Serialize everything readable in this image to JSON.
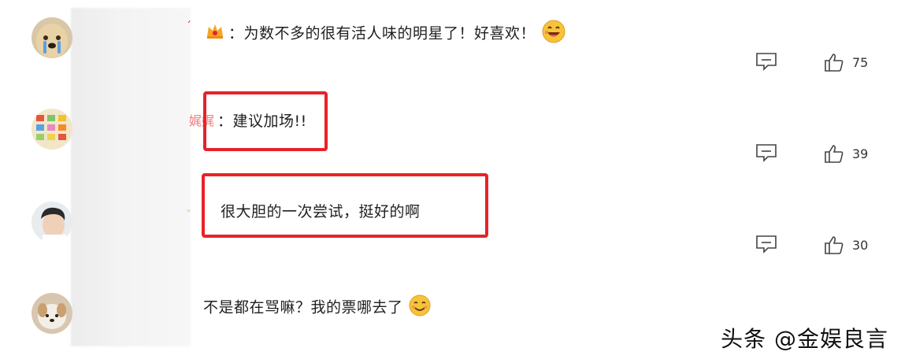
{
  "comments": [
    {
      "name_fragment": "",
      "separator": "：",
      "text": "为数不多的很有活人味的明星了！好喜欢！",
      "replies_icon": "reply-icon",
      "likes": "75"
    },
    {
      "name_fragment": "",
      "separator": "：",
      "text": "建议加场!!",
      "replies_icon": "reply-icon",
      "likes": "39"
    },
    {
      "name_fragment": "",
      "separator": "",
      "text": "很大胆的一次尝试，挺好的啊",
      "replies_icon": "reply-icon",
      "likes": "30"
    },
    {
      "name_fragment": "",
      "separator": "",
      "text": "不是都在骂嘛？我的票哪去了",
      "replies_icon": "reply-icon",
      "likes": ""
    }
  ],
  "watermark": "头条 @金娱良言",
  "colors": {
    "highlight": "#e8222a",
    "text": "#1f1f1f",
    "emoji": "#f6c33a"
  }
}
